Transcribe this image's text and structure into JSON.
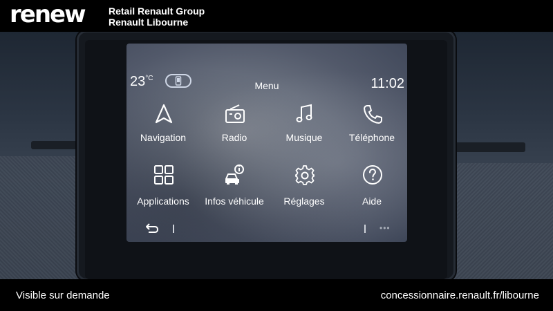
{
  "banner": {
    "logo": "renew",
    "group_name": "Retail Renault Group",
    "dealer_name": "Renault Libourne"
  },
  "screen": {
    "temperature": "23",
    "temperature_unit": "°C",
    "title": "Menu",
    "clock": "11:02",
    "phone_icon": "phone-connected-icon",
    "tiles": [
      {
        "label": "Navigation",
        "icon": "navigation-arrow-icon"
      },
      {
        "label": "Radio",
        "icon": "radio-icon"
      },
      {
        "label": "Musique",
        "icon": "music-note-icon"
      },
      {
        "label": "Téléphone",
        "icon": "phone-handset-icon"
      },
      {
        "label": "Applications",
        "icon": "apps-grid-icon"
      },
      {
        "label": "Infos véhicule",
        "icon": "car-info-icon"
      },
      {
        "label": "Réglages",
        "icon": "gear-icon"
      },
      {
        "label": "Aide",
        "icon": "help-question-icon"
      }
    ],
    "bottom_bar": {
      "back_icon": "back-arrow-icon",
      "more_icon": "more-dots-icon"
    }
  },
  "footer": {
    "left_text": "Visible sur demande",
    "right_text": "concessionnaire.renault.fr/libourne"
  },
  "colors": {
    "banner_bg": "#000000",
    "screen_text": "#ffffff",
    "bezel": "#15191f"
  }
}
